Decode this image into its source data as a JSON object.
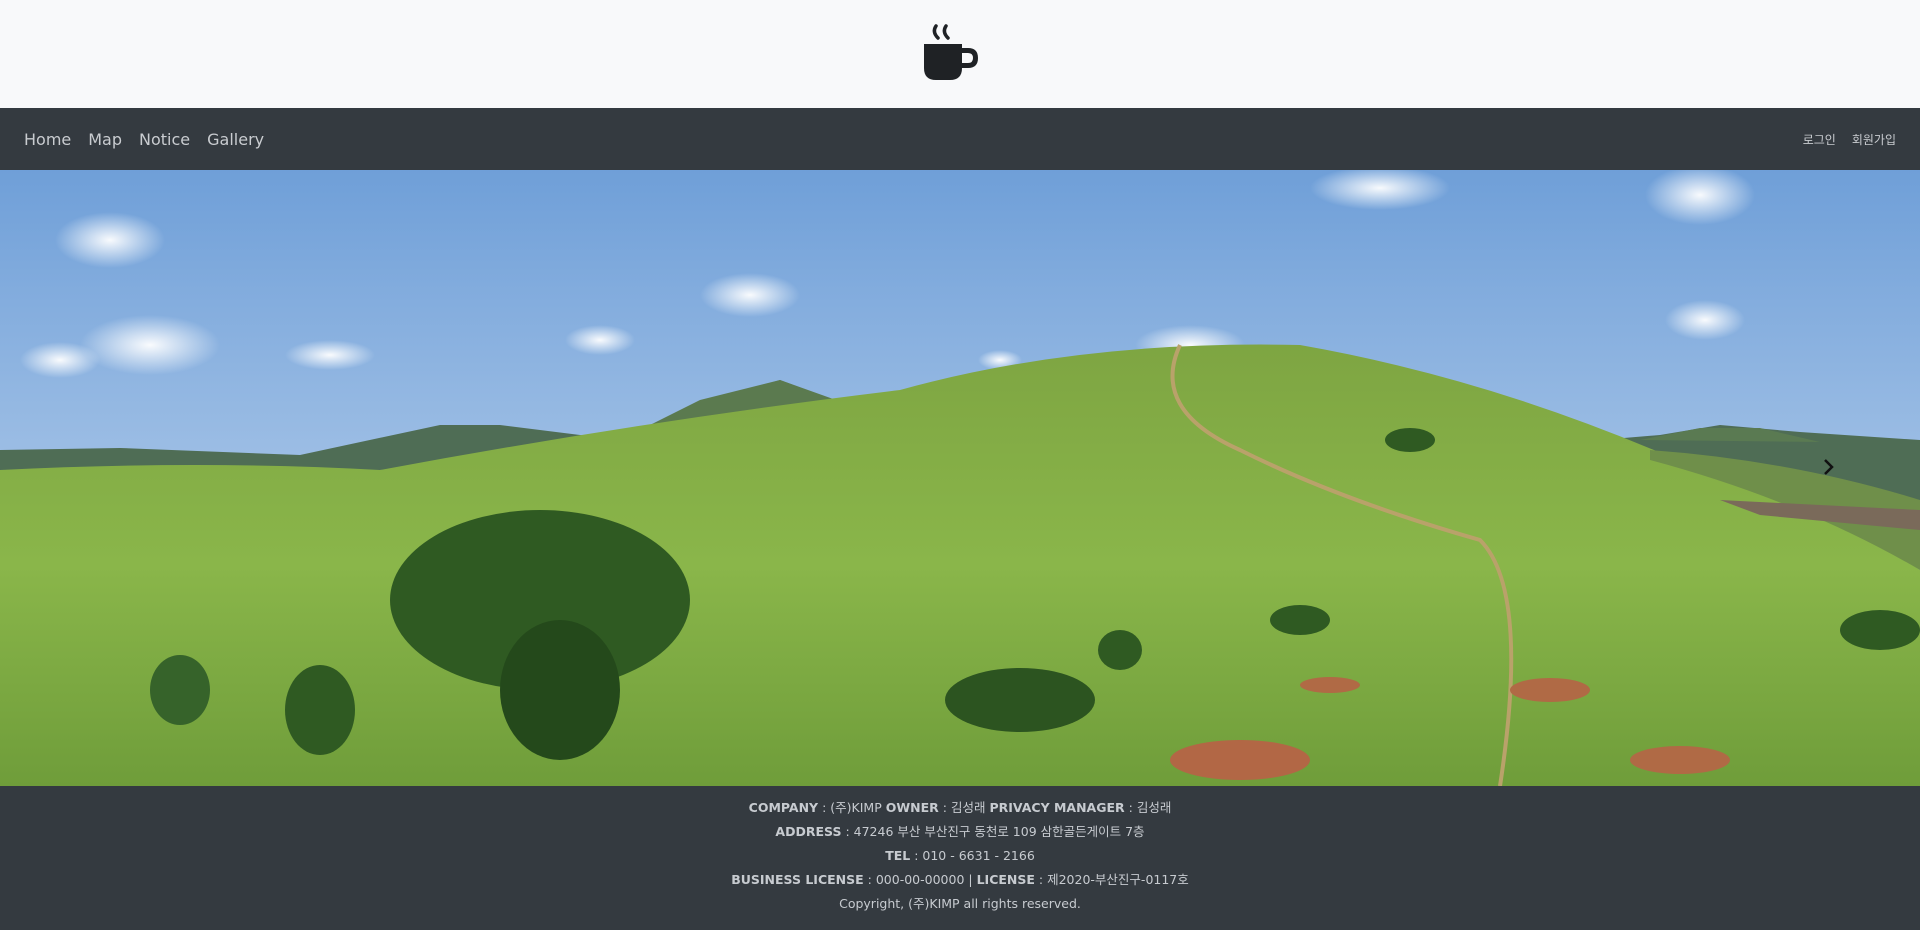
{
  "header": {
    "logo_icon": "coffee-cup-icon"
  },
  "nav": {
    "left": [
      "Home",
      "Map",
      "Notice",
      "Gallery"
    ],
    "right": [
      "로그인",
      "회원가입"
    ]
  },
  "hero": {
    "next_icon": "chevron-right-icon"
  },
  "footer": {
    "company_label": "COMPANY",
    "company_value": "(주)KIMP",
    "owner_label": "OWNER",
    "owner_value": "김성래",
    "privacy_label": "PRIVACY MANAGER",
    "privacy_value": "김성래",
    "address_label": "ADDRESS",
    "address_value": "47246 부산 부산진구 동천로 109 삼한골든게이트 7층",
    "tel_label": "TEL",
    "tel_value": "010 - 6631 - 2166",
    "business_label": "BUSINESS LICENSE",
    "business_value": "000-00-00000",
    "license_label": "LICENSE",
    "license_value": "제2020-부산진구-0117호",
    "copyright": "Copyright, (주)KIMP all rights reserved."
  },
  "colors": {
    "nav_bg": "#343a40",
    "top_bg": "#f8f9fa",
    "footer_bg": "#343a40",
    "text_light": "#c9ccd0"
  }
}
